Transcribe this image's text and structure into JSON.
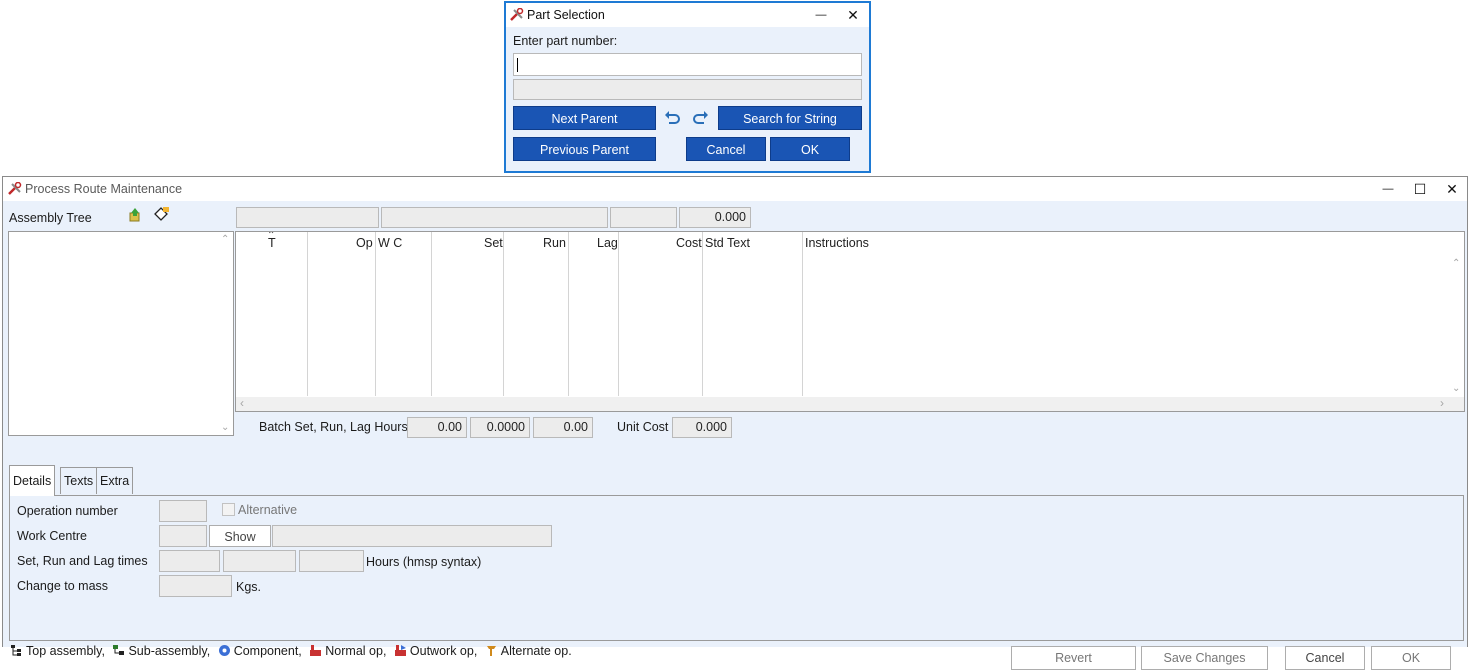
{
  "dialog": {
    "title": "Part Selection",
    "prompt": "Enter part number:",
    "part_input_value": "",
    "buttons": {
      "next_parent": "Next Parent",
      "previous_parent": "Previous Parent",
      "search_for_string": "Search for String",
      "cancel": "Cancel",
      "ok": "OK"
    }
  },
  "window": {
    "title": "Process Route Maintenance",
    "controls": {
      "minimize": "—",
      "maximize": "☐",
      "close": "✕"
    }
  },
  "assembly_tree": {
    "label": "Assembly Tree"
  },
  "top_fields": {
    "total": "0.000"
  },
  "grid": {
    "columns": [
      "T",
      "Op",
      "W C",
      "Set",
      "Run",
      "Lag",
      "Cost",
      "Std Text",
      "Instructions"
    ]
  },
  "batch": {
    "label": "Batch Set, Run, Lag Hours",
    "set": "0.00",
    "run": "0.0000",
    "lag": "0.00",
    "unit_cost_label": "Unit Cost",
    "unit_cost": "0.000"
  },
  "tabs": [
    "Details",
    "Texts",
    "Extra"
  ],
  "details": {
    "operation_number_label": "Operation number",
    "alternative_label": "Alternative",
    "work_centre_label": "Work Centre",
    "show_button": "Show",
    "times_label": "Set, Run and Lag times",
    "hours_label": "Hours (hmsp syntax)",
    "mass_label": "Change to mass",
    "kgs_label": "Kgs."
  },
  "legend": {
    "top_assembly": "Top assembly,",
    "sub_assembly": "Sub-assembly,",
    "component": "Component,",
    "normal_op": "Normal op,",
    "outwork_op": "Outwork op,",
    "alternate_op": "Alternate op."
  },
  "footer_buttons": {
    "revert": "Revert",
    "save_changes": "Save Changes",
    "cancel": "Cancel",
    "ok": "OK"
  },
  "colors": {
    "accent": "#1a55b4",
    "dialog_border": "#1e7ad4",
    "client_bg": "#eaf1fb"
  }
}
